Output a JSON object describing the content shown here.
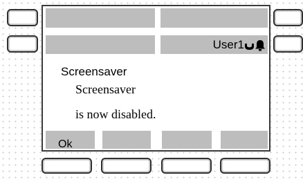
{
  "status": {
    "user_label": "User1",
    "handset_icon": "handset-icon",
    "bell_icon": "bell-icon"
  },
  "message": {
    "title": "Screensaver",
    "line1": "Screensaver",
    "line2": "is now disabled."
  },
  "softkeys": [
    {
      "label": "Ok"
    },
    {
      "label": ""
    },
    {
      "label": ""
    },
    {
      "label": ""
    }
  ],
  "colors": {
    "screen_fill": "#ffffff",
    "cell_grey": "#bdbdbd",
    "border": "#303030"
  }
}
